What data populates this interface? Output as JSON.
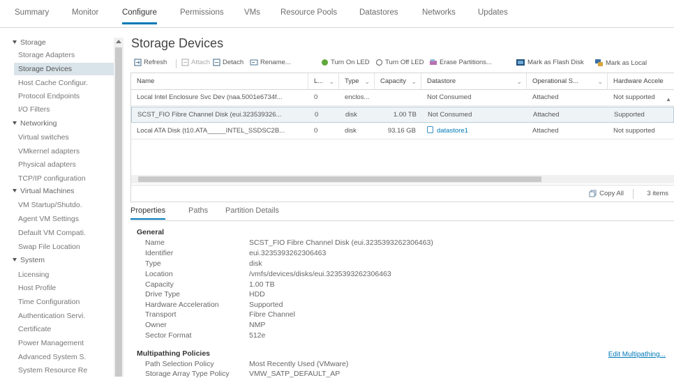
{
  "tabs": [
    "Summary",
    "Monitor",
    "Configure",
    "Permissions",
    "VMs",
    "Resource Pools",
    "Datastores",
    "Networks",
    "Updates"
  ],
  "nav": {
    "storage": {
      "label": "Storage",
      "items": [
        "Storage Adapters",
        "Storage Devices",
        "Host Cache Configur.",
        "Protocol Endpoints",
        "I/O Filters"
      ]
    },
    "networking": {
      "label": "Networking",
      "items": [
        "Virtual switches",
        "VMkernel adapters",
        "Physical adapters",
        "TCP/IP configuration"
      ]
    },
    "vms": {
      "label": "Virtual Machines",
      "items": [
        "VM Startup/Shutdo.",
        "Agent VM Settings",
        "Default VM Compati.",
        "Swap File Location"
      ]
    },
    "system": {
      "label": "System",
      "items": [
        "Licensing",
        "Host Profile",
        "Time Configuration",
        "Authentication Servi.",
        "Certificate",
        "Power Management",
        "Advanced System S.",
        "System Resource Re"
      ]
    }
  },
  "page_title": "Storage Devices",
  "toolbar": {
    "refresh": "Refresh",
    "attach": "Attach",
    "detach": "Detach",
    "rename": "Rename...",
    "turn_on_led": "Turn On LED",
    "turn_off_led": "Turn Off LED",
    "erase": "Erase Partitions...",
    "flash": "Mark as Flash Disk",
    "local": "Mark as Local"
  },
  "grid": {
    "headers": {
      "name": "Name",
      "lun": "L...",
      "type": "Type",
      "capacity": "Capacity",
      "datastore": "Datastore",
      "opstate": "Operational S...",
      "hwaccel": "Hardware Accele"
    },
    "rows": [
      {
        "name": "Local Intel Enclosure Svc Dev (naa.5001e6734f...",
        "lun": "0",
        "type": "enclos...",
        "capacity": "",
        "datastore": "Not Consumed",
        "opstate": "Attached",
        "hwaccel": "Not supported"
      },
      {
        "name": "SCST_FIO Fibre Channel Disk (eui.323539326...",
        "lun": "0",
        "type": "disk",
        "capacity": "1.00 TB",
        "datastore": "Not Consumed",
        "opstate": "Attached",
        "hwaccel": "Supported"
      },
      {
        "name": "Local ATA Disk (t10.ATA_____INTEL_SSDSC2B...",
        "lun": "0",
        "type": "disk",
        "capacity": "93.16 GB",
        "datastore": "datastore1",
        "opstate": "Attached",
        "hwaccel": "Not supported"
      }
    ],
    "copy_all": "Copy All",
    "item_count": "3 items"
  },
  "subtabs": [
    "Properties",
    "Paths",
    "Partition Details"
  ],
  "props": {
    "general_title": "General",
    "fields": [
      {
        "label": "Name",
        "value": "SCST_FIO Fibre Channel Disk (eui.3235393262306463)"
      },
      {
        "label": "Identifier",
        "value": "eui.3235393262306463"
      },
      {
        "label": "Type",
        "value": "disk"
      },
      {
        "label": "Location",
        "value": "/vmfs/devices/disks/eui.3235393262306463"
      },
      {
        "label": "Capacity",
        "value": "1.00 TB"
      },
      {
        "label": "Drive Type",
        "value": "HDD"
      },
      {
        "label": "Hardware Acceleration",
        "value": "Supported"
      },
      {
        "label": "Transport",
        "value": "Fibre Channel"
      },
      {
        "label": "Owner",
        "value": "NMP"
      },
      {
        "label": "Sector Format",
        "value": "512e"
      }
    ],
    "multipath_title": "Multipathing Policies",
    "multipath": [
      {
        "label": "Path Selection Policy",
        "value": "Most Recently Used (VMware)"
      },
      {
        "label": "Storage Array Type Policy",
        "value": "VMW_SATP_DEFAULT_AP"
      }
    ],
    "edit_link": "Edit Multipathing..."
  }
}
